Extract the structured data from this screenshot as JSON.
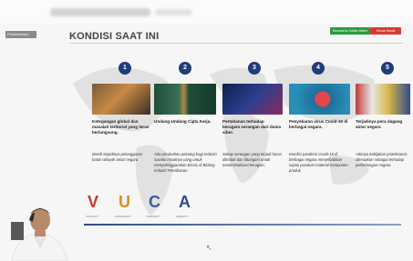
{
  "slide": {
    "title": "KONDISI SAAT INI",
    "left_tag": "Pendahuluan",
    "buttons": {
      "green": "Kembali ke Daftar Materi",
      "red": "Keluar Modul"
    },
    "items": [
      {
        "num": "1",
        "caption": "Ketegangan global dan masalah teritorial yang terus berlangsung.",
        "desc": "Masih terjadinya pelanggaran batas wilayah antar negara"
      },
      {
        "num": "2",
        "caption": "Undang-Undang Cipta Kerja.",
        "desc": "Ada perubahan peluang bagi Industri suvaku misalnya yang untuk menyelenggarakan Bisnis di Bidang Industri Pertahanan"
      },
      {
        "num": "3",
        "caption": "Pertahanan terhadap beragam serangan dari dunia siber.",
        "desc": "Setiap serangan yang terjadi harus ditindak dan ditangani untuk meminimalisasi kerugian."
      },
      {
        "num": "4",
        "caption": "Penyebaran virus Covid-19 di berbagai negara.",
        "desc": "Kondisi pandemi Covid-19 di berbagai negara menyebabkan suplai pasokan material komponen produk"
      },
      {
        "num": "5",
        "caption": "Terjadinya pera dagang antar negara",
        "desc": "Adanya kebijakan proteksionis diterapkan sebagai terhadap perlindungan negara"
      }
    ],
    "vuca": [
      "V",
      "U",
      "C",
      "A"
    ],
    "vuca_sub": [
      "VOLATILITY",
      "UNCERTAINTY",
      "COMPLEXITY",
      "AMBIGUITY"
    ]
  },
  "colors": {
    "accent": "#1f3d7a",
    "green": "#2a9c3b",
    "red": "#d73a34",
    "v": "#c23a2b",
    "u": "#e08a1e",
    "c": "#3d5a9c",
    "a": "#2f4b8a"
  }
}
